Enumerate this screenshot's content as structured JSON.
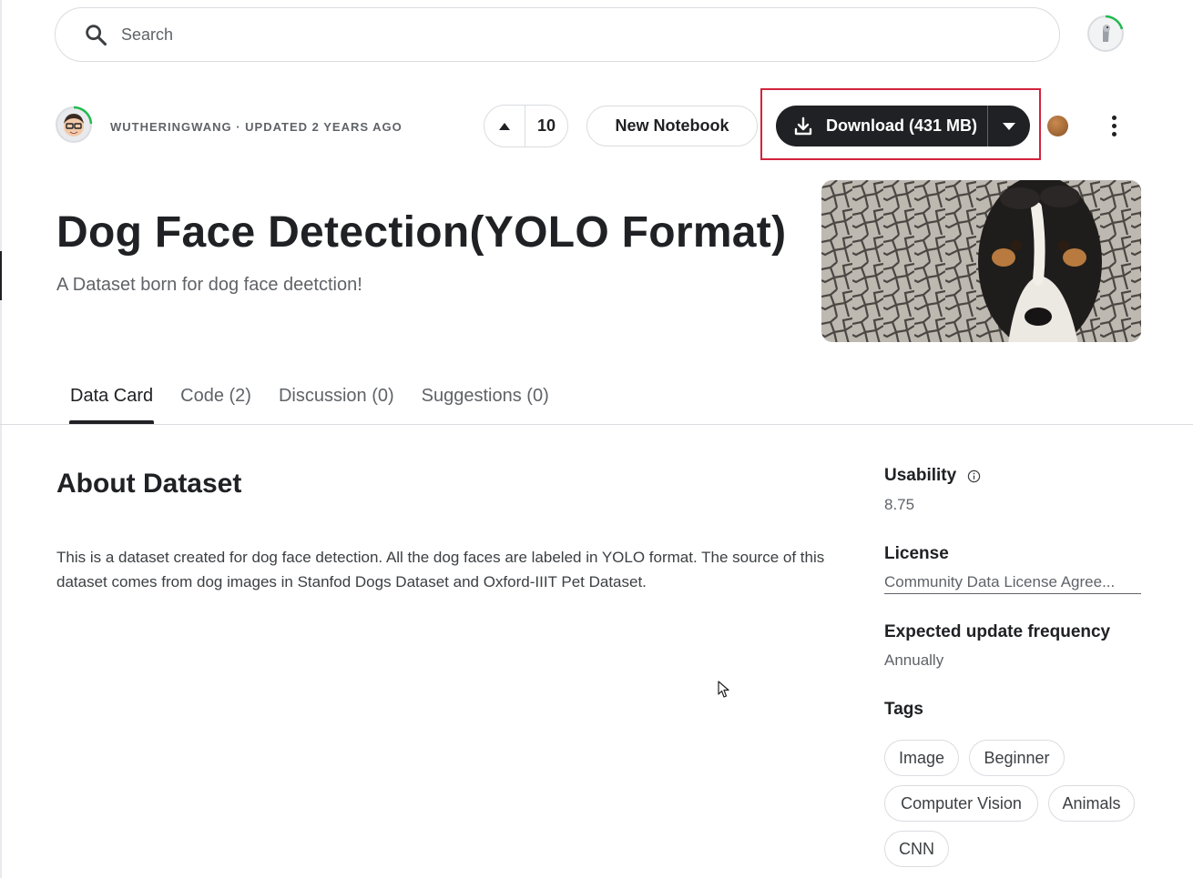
{
  "search": {
    "placeholder": "Search"
  },
  "owner": {
    "line": "WUTHERINGWANG · UPDATED 2 YEARS AGO"
  },
  "vote": {
    "count": "10"
  },
  "actions": {
    "new_notebook": "New Notebook",
    "download": "Download (431 MB)"
  },
  "dataset": {
    "title": "Dog Face Detection(YOLO Format)",
    "subtitle": "A Dataset born for dog face deetction!"
  },
  "tabs": [
    {
      "label": "Data Card",
      "active": true
    },
    {
      "label": "Code (2)",
      "active": false
    },
    {
      "label": "Discussion (0)",
      "active": false
    },
    {
      "label": "Suggestions (0)",
      "active": false
    }
  ],
  "about": {
    "title": "About Dataset",
    "text": "This is a dataset created for dog face detection. All the dog faces are labeled in YOLO format. The source of this dataset comes from dog images in Stanfod Dogs Dataset and Oxford-IIIT Pet Dataset."
  },
  "sidebar": {
    "usability_label": "Usability",
    "usability_value": "8.75",
    "license_label": "License",
    "license_value": "Community Data License Agree...",
    "frequency_label": "Expected update frequency",
    "frequency_value": "Annually",
    "tags_label": "Tags",
    "tags": [
      "Image",
      "Beginner",
      "Computer Vision",
      "Animals",
      "CNN"
    ]
  },
  "colors": {
    "primary_button": "#202124",
    "highlight_box": "#d2233c",
    "progress_ring": "#20ba4e"
  }
}
